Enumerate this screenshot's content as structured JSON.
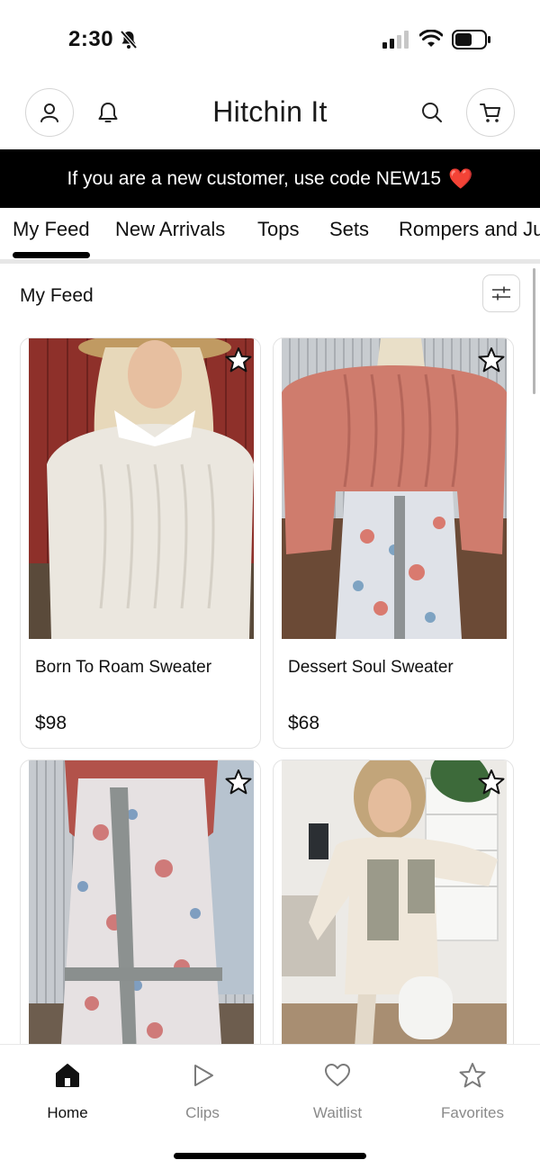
{
  "status_bar": {
    "time": "2:30",
    "icons": [
      "bell-off-icon",
      "signal-icon",
      "wifi-icon",
      "battery-icon"
    ]
  },
  "header": {
    "title": "Hitchin It",
    "icons": [
      "account-icon",
      "bell-icon",
      "search-icon",
      "cart-icon"
    ]
  },
  "promo": {
    "text": "If you are a new customer, use code NEW15",
    "emoji": "❤️"
  },
  "tabs": [
    "My Feed",
    "New Arrivals",
    "Tops",
    "Sets",
    "Rompers and Jumpsuits"
  ],
  "active_tab": "My Feed",
  "feed": {
    "title": "My Feed",
    "products": [
      {
        "name": "Born To Roam Sweater",
        "price": "$98"
      },
      {
        "name": "Dessert Soul Sweater",
        "price": "$68"
      },
      {
        "name": "",
        "price": ""
      },
      {
        "name": "",
        "price": ""
      }
    ]
  },
  "bottom_nav": [
    {
      "label": "Home",
      "icon": "home-icon",
      "active": true
    },
    {
      "label": "Clips",
      "icon": "play-icon",
      "active": false
    },
    {
      "label": "Waitlist",
      "icon": "heart-icon",
      "active": false
    },
    {
      "label": "Favorites",
      "icon": "star-icon",
      "active": false
    }
  ],
  "colors": {
    "promo_bg": "#000000",
    "heart": "#e3222c",
    "inactive_nav": "#8a8a8a"
  }
}
